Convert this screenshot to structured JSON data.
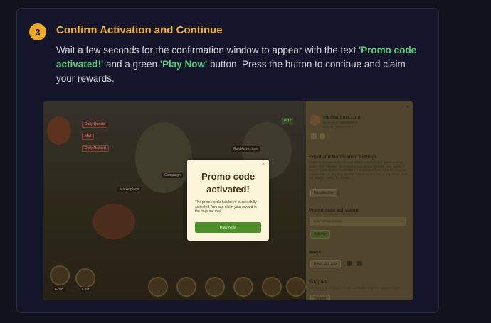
{
  "step": {
    "number": "3",
    "title": "Confirm Activation and Continue",
    "desc_1": "Wait a few seconds for the confirmation window to appear with the text ",
    "desc_hl_1": "'Promo code activated!'",
    "desc_2": " and a green ",
    "desc_hl_2": "'Play Now'",
    "desc_3": " button. Press the button to continue and claim your rewards."
  },
  "colors": {
    "accent": "#f4b421",
    "highlight": "#55cf7a",
    "button": "#4f8f2a"
  },
  "game": {
    "menu_1": "Daily Quests",
    "menu_2": "Mail",
    "menu_3": "Daily Reward",
    "hud_value": "1032",
    "tag_1": "Raid Adventure",
    "tag_2": "Campaign",
    "tag_3": "Marketplace",
    "bottom_left": "Guild",
    "bottom_left_2": "Chat"
  },
  "panel": {
    "close": "×",
    "email": "me@solfors.com",
    "line_1": "Nickname: 1686844603",
    "line_2": "UserID: 1686844603",
    "notif_heading": "Email and Notification Settings",
    "notif_text": "I want to receive news, special offers, surveys, and game-testing invites from Nexters. By entering your email address, you agree to receive promotional newsletters and updates from Nexters. You can unsubscribe at any time via the \"Unsubscribe\" link in any email. See our Privacy Policy for details.",
    "unsubscribe": "Unsubscribe",
    "promo_heading": "Promo code activation",
    "promo_value": "SOLFORS4GIN026",
    "activate": "Activate",
    "news_heading": "News",
    "news_button": "News and gifts",
    "support_heading": "Support",
    "support_text": "Get help and answers to your questions from our support team.",
    "support_button": "Support"
  },
  "modal": {
    "close": "×",
    "title": "Promo code activated!",
    "text": "The promo code has been successfully activated. You can claim your reward in the in-game mail.",
    "button": "Play Now"
  }
}
